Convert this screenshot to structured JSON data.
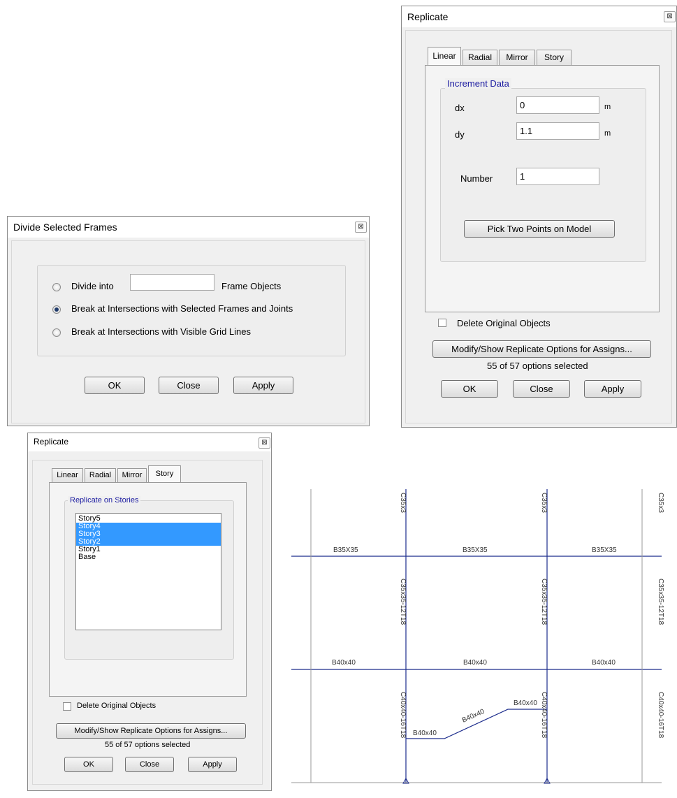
{
  "divide_dialog": {
    "title": "Divide Selected Frames",
    "close_glyph": "⊠",
    "options": [
      {
        "label": "Divide into",
        "checked": false
      },
      {
        "label": "Break at Intersections with Selected Frames and Joints",
        "checked": true
      },
      {
        "label": "Break at Intersections with Visible Grid Lines",
        "checked": false
      }
    ],
    "divide_value": "",
    "frame_objects_label": "Frame Objects",
    "buttons": {
      "ok": "OK",
      "close": "Close",
      "apply": "Apply"
    }
  },
  "replicate_linear": {
    "title": "Replicate",
    "close_glyph": "⊠",
    "tabs": [
      "Linear",
      "Radial",
      "Mirror",
      "Story"
    ],
    "active_tab": "Linear",
    "group_title": "Increment Data",
    "dx_label": "dx",
    "dx_value": "0",
    "dx_unit": "m",
    "dy_label": "dy",
    "dy_value": "1.1",
    "dy_unit": "m",
    "number_label": "Number",
    "number_value": "1",
    "pick_button": "Pick Two Points on Model",
    "delete_label": "Delete Original Objects",
    "modify_button": "Modify/Show Replicate Options for Assigns...",
    "options_status": "55 of 57 options selected",
    "buttons": {
      "ok": "OK",
      "close": "Close",
      "apply": "Apply"
    }
  },
  "replicate_story": {
    "title": "Replicate",
    "close_glyph": "⊠",
    "tabs": [
      "Linear",
      "Radial",
      "Mirror",
      "Story"
    ],
    "active_tab": "Story",
    "group_title": "Replicate on Stories",
    "stories": [
      {
        "name": "Story5",
        "selected": false
      },
      {
        "name": "Story4",
        "selected": true
      },
      {
        "name": "Story3",
        "selected": true
      },
      {
        "name": "Story2",
        "selected": true
      },
      {
        "name": "Story1",
        "selected": false
      },
      {
        "name": "Base",
        "selected": false
      }
    ],
    "delete_label": "Delete Original Objects",
    "modify_button": "Modify/Show Replicate Options for Assigns...",
    "options_status": "55 of 57 options selected",
    "buttons": {
      "ok": "OK",
      "close": "Close",
      "apply": "Apply"
    }
  },
  "model_view": {
    "column_top_labels": [
      "C35x3",
      "C35x3",
      "C35x3"
    ],
    "beam_top_labels": [
      "B35X35",
      "B35X35",
      "B35X35"
    ],
    "column_mid_labels": [
      "C35x35-12T18",
      "C35x35-12T18",
      "C35x35-12T18"
    ],
    "beam_mid_labels": [
      "B40x40",
      "B40x40",
      "B40x40"
    ],
    "column_bottom_labels": [
      "C40x40-16T18",
      "C40x40-16T18",
      "C40x40-16T18"
    ],
    "new_beam_labels": [
      "B40x40",
      "B40x40",
      "B40x40"
    ],
    "colors": {
      "frame": "#1c2c8c",
      "grid": "#9a9a9a",
      "text": "#333333"
    }
  }
}
